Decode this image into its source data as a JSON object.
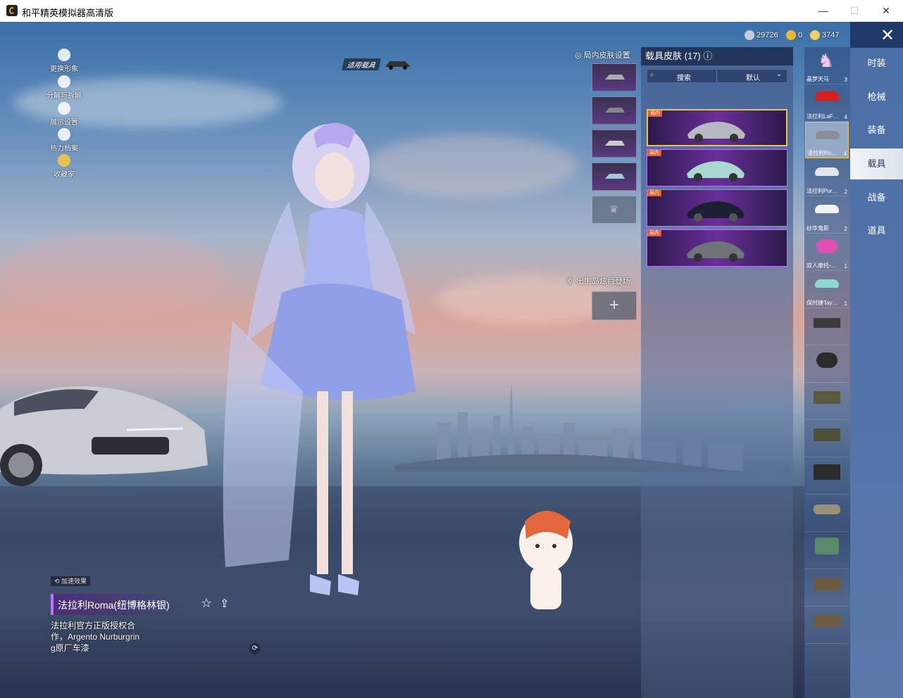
{
  "window": {
    "title": "和平精英模拟器高清版",
    "minimize": "—",
    "maximize": "☐",
    "close": "✕"
  },
  "currency": [
    {
      "value": "29726",
      "color": "#c8c8d8"
    },
    {
      "value": "0",
      "color": "#e8b830"
    },
    {
      "value": "3747",
      "color": "#f0d060"
    }
  ],
  "left_menu": [
    {
      "label": "更换形象",
      "icon": "avatar-icon"
    },
    {
      "label": "分解与拆解",
      "icon": "puzzle-icon"
    },
    {
      "label": "展示设置",
      "icon": "eye-icon"
    },
    {
      "label": "热力档案",
      "icon": "flame-icon"
    },
    {
      "label": "收藏家",
      "icon": "collector-badge-icon"
    }
  ],
  "applicable_vehicle": "适用载具",
  "ingame_skin_settings": "局内皮肤设置",
  "spawn_island_label": "出生岛炫目登场",
  "spawn_plus": "+",
  "skin_panel": {
    "title": "载具皮肤 (17)",
    "search_placeholder": "搜索",
    "sort_label": "默认",
    "cards": [
      {
        "tag": "局内",
        "color": "#b8b8c0"
      },
      {
        "tag": "局内",
        "color": "#a8d8d0"
      },
      {
        "tag": "局内",
        "color": "#1a2030"
      },
      {
        "tag": "局内",
        "color": "#707478"
      }
    ]
  },
  "vehicle_list": [
    {
      "label": "晶梦天马",
      "count": "3"
    },
    {
      "label": "法拉利LaF…",
      "count": "4"
    },
    {
      "label": "法拉利Ro…",
      "count": "4"
    },
    {
      "label": "法拉利Pur…",
      "count": "2"
    },
    {
      "label": "纱华鬼影",
      "count": "2"
    },
    {
      "label": "双人摩托-…",
      "count": "1"
    },
    {
      "label": "保时捷Tay…",
      "count": "1"
    },
    {
      "label": "",
      "count": ""
    },
    {
      "label": "",
      "count": ""
    },
    {
      "label": "",
      "count": ""
    },
    {
      "label": "",
      "count": ""
    },
    {
      "label": "",
      "count": ""
    },
    {
      "label": "",
      "count": ""
    },
    {
      "label": "",
      "count": ""
    },
    {
      "label": "",
      "count": ""
    },
    {
      "label": "",
      "count": ""
    }
  ],
  "categories": [
    "时装",
    "枪械",
    "装备",
    "载具",
    "战备",
    "道具"
  ],
  "active_category": "载具",
  "boost_tag": "加速效果",
  "vehicle_name": "法拉利Roma(纽博格林银)",
  "vehicle_desc": [
    "法拉利官方正版授权合",
    "作，Argento Nurburgrin",
    "g原厂车漆"
  ]
}
